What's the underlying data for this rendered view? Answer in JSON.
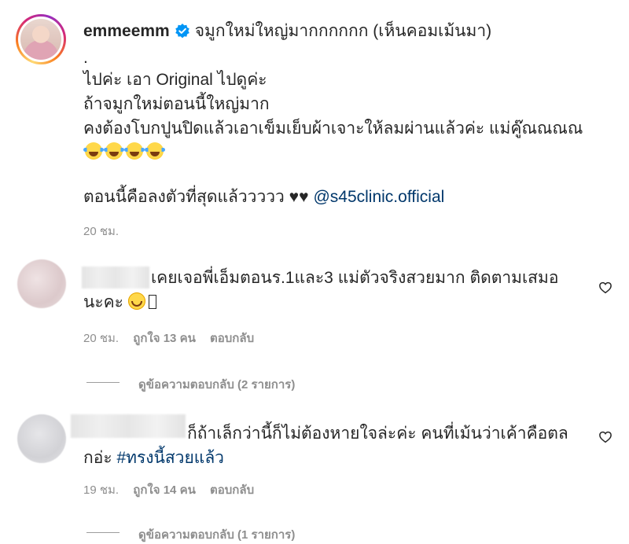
{
  "caption": {
    "username": "emmeemm",
    "title": "จมูกใหม่ใหญ่มากกกกกก (เห็นคอมเม้นมา)",
    "dot": ".",
    "line1": "ไปค่ะ เอา Original ไปดูค่ะ",
    "line2": "ถ้าจมูกใหม่ตอนนี้ใหญ่มาก",
    "line3": "คงต้องโบกปูนปิดแล้วเอาเข็มเย็บผ้าเจาะให้ลมผ่านแล้วค่ะ แม่คู๊ณณณณ",
    "line5_text": "ตอนนี้คือลงตัวที่สุดแล้ววววว ♥♥",
    "mention": "@s45clinic.official",
    "time": "20 ชม.",
    "emoji_count": 4,
    "emoji_name": "face-with-tears-of-joy-icon"
  },
  "comments": [
    {
      "text_line1": "เคยเจอพี่เอ็มตอนร.1และ3 แม่ตัวจริงสวยมาก ติดตามเสมอ",
      "text_line2": "นะคะ",
      "time": "20 ชม.",
      "likes": "ถูกใจ 13 คน",
      "reply": "ตอบกลับ",
      "view_replies": "ดูข้อความตอบกลับ (2 รายการ)"
    },
    {
      "text_line1": "ก็ถ้าเล็กว่านี้ก็ไม่ต้องหายใจล่ะค่ะ คนที่เม้นว่าเค้าคือตล",
      "text_line2_prefix": "กอ่ะ ",
      "hashtag": "#ทรงนี้สวยแล้ว",
      "time": "19 ชม.",
      "likes": "ถูกใจ 14 คน",
      "reply": "ตอบกลับ",
      "view_replies": "ดูข้อความตอบกลับ (1 รายการ)"
    }
  ],
  "colors": {
    "link": "#00376b",
    "muted": "#8e8e8e",
    "verified": "#0095f6"
  }
}
